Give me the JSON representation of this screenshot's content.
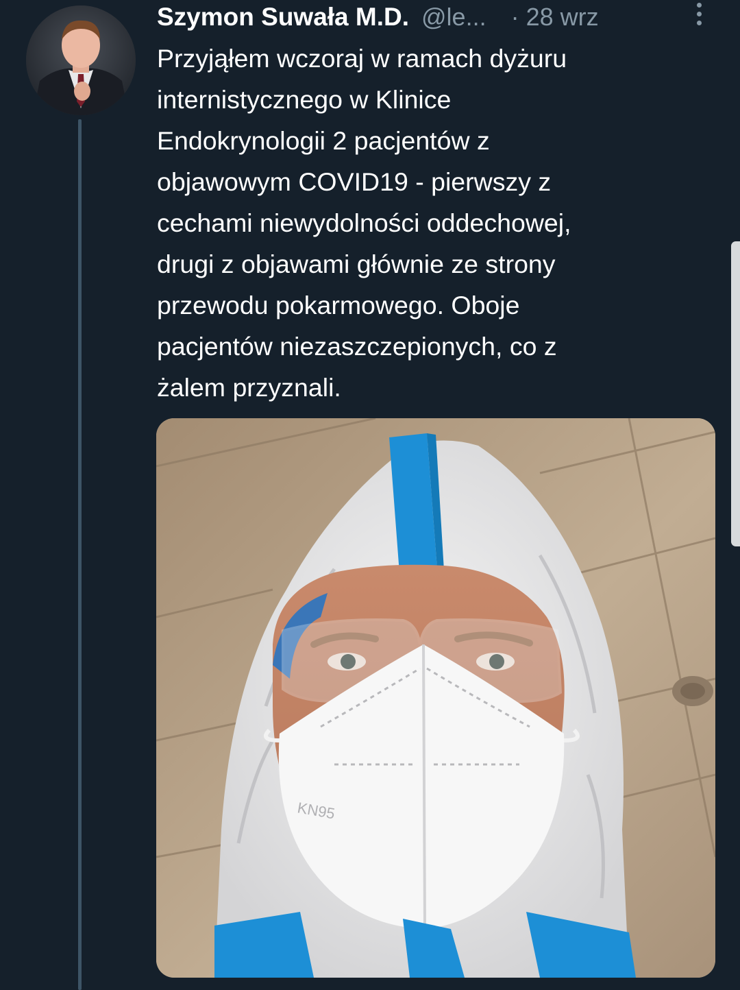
{
  "tweet": {
    "display_name": "Szymon Suwała M.D.",
    "handle": "@le...",
    "timestamp": "· 28 wrz",
    "text": "Przyjąłem wczoraj w ramach dyżuru\ninternistycznego w Klinice\nEndokrynologii 2 pacjentów z\nobjawowym COVID19 - pierwszy z\ncechami niewydolności oddechowej,\ndrugi z objawami głównie ze strony\nprzewodu pokarmowego. Oboje\npacjentów niezaszczepionych, co z\nżalem przyznali.",
    "mask_text": "KN95"
  },
  "icons": {
    "more": "vertical-ellipsis-icon"
  },
  "colors": {
    "background": "#15202b",
    "secondary_text": "#8899a6",
    "thread_line": "#3d5466"
  }
}
